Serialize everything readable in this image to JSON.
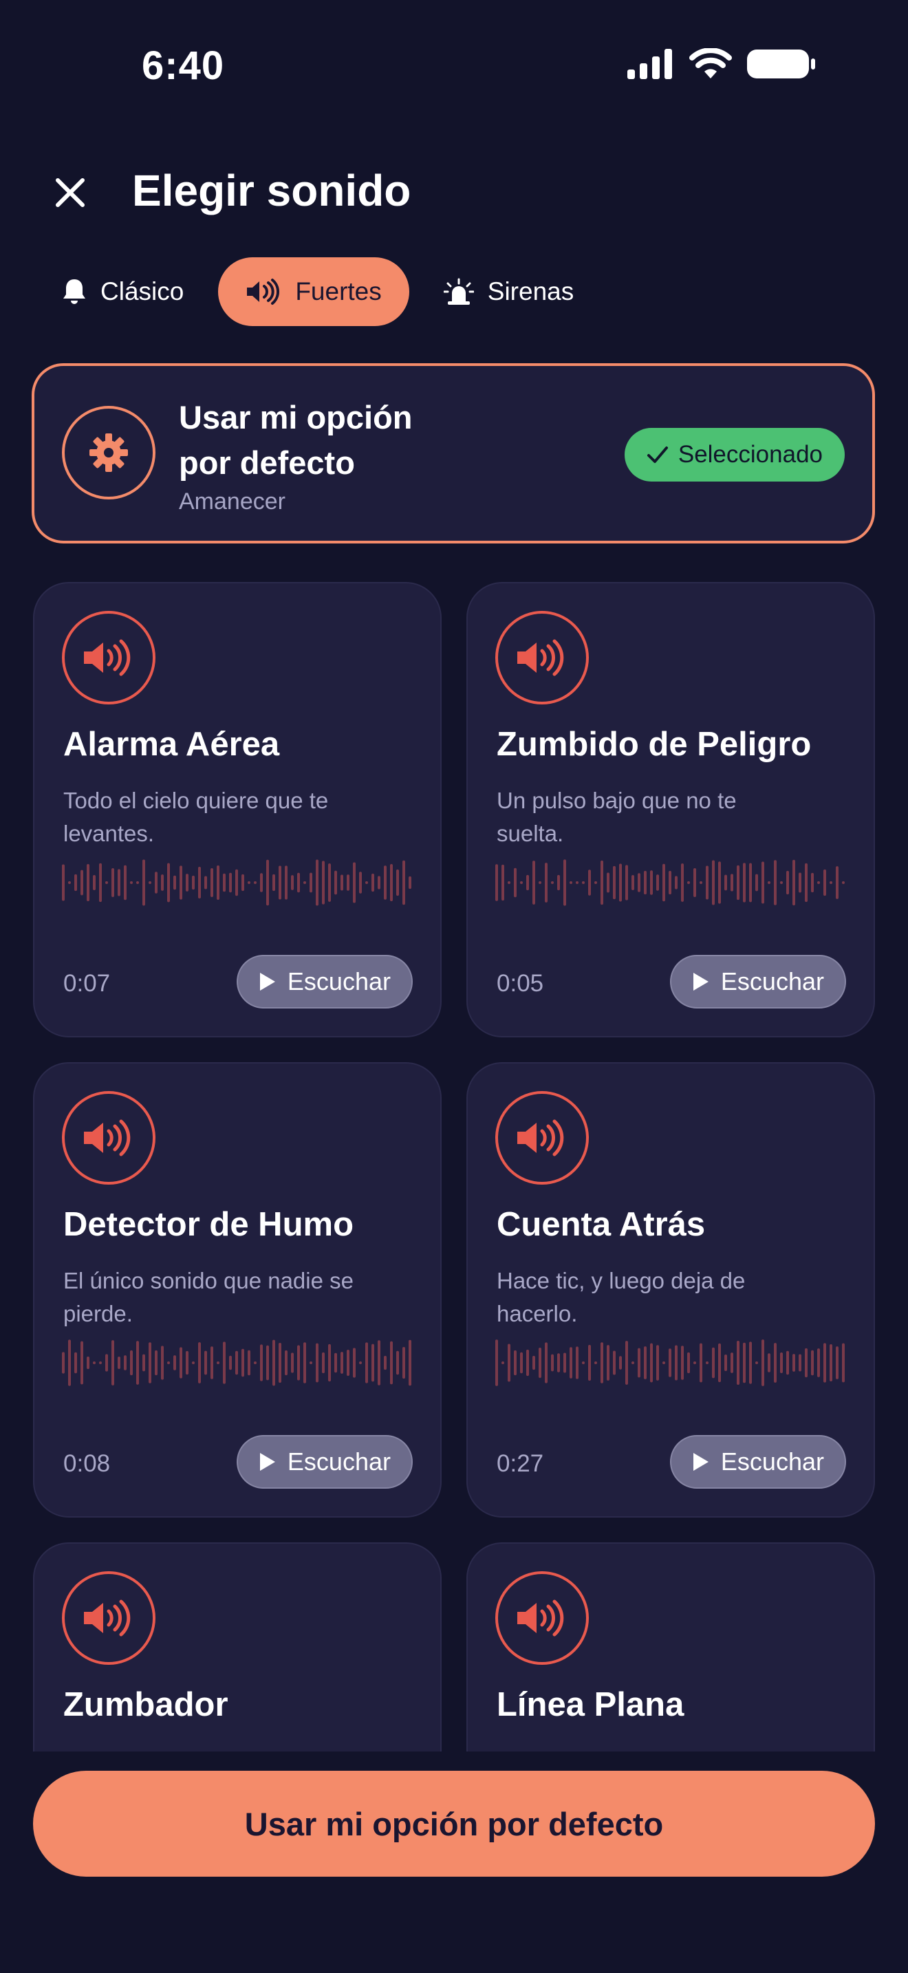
{
  "status_bar": {
    "time": "6:40"
  },
  "header": {
    "title": "Elegir sonido"
  },
  "tabs": [
    {
      "label": "Clásico",
      "icon": "bell-icon",
      "active": false
    },
    {
      "label": "Fuertes",
      "icon": "speaker-loud-icon",
      "active": true
    },
    {
      "label": "Sirenas",
      "icon": "siren-icon",
      "active": false
    }
  ],
  "default_option": {
    "title": "Usar mi opción por defecto",
    "subtitle": "Amanecer",
    "badge": "Seleccionado",
    "icon": "gear-icon"
  },
  "sounds": [
    {
      "name": "Alarma Aérea",
      "description": "Todo el cielo quiere que te levantes.",
      "duration": "0:07",
      "button": "Escuchar"
    },
    {
      "name": "Zumbido de Peligro",
      "description": "Un pulso bajo que no te suelta.",
      "duration": "0:05",
      "button": "Escuchar"
    },
    {
      "name": "Detector de Humo",
      "description": "El único sonido que nadie se pierde.",
      "duration": "0:08",
      "button": "Escuchar"
    },
    {
      "name": "Cuenta Atrás",
      "description": "Hace tic, y luego deja de hacerlo.",
      "duration": "0:27",
      "button": "Escuchar"
    },
    {
      "name": "Zumbador",
      "description": "",
      "duration": "",
      "button": ""
    },
    {
      "name": "Línea Plana",
      "description": "",
      "duration": "",
      "button": ""
    }
  ],
  "cta": {
    "label": "Usar mi opción por defecto"
  },
  "colors": {
    "background": "#12132a",
    "accent": "#f48b6a",
    "selected": "#4cc173",
    "speaker": "#e95a4e"
  }
}
